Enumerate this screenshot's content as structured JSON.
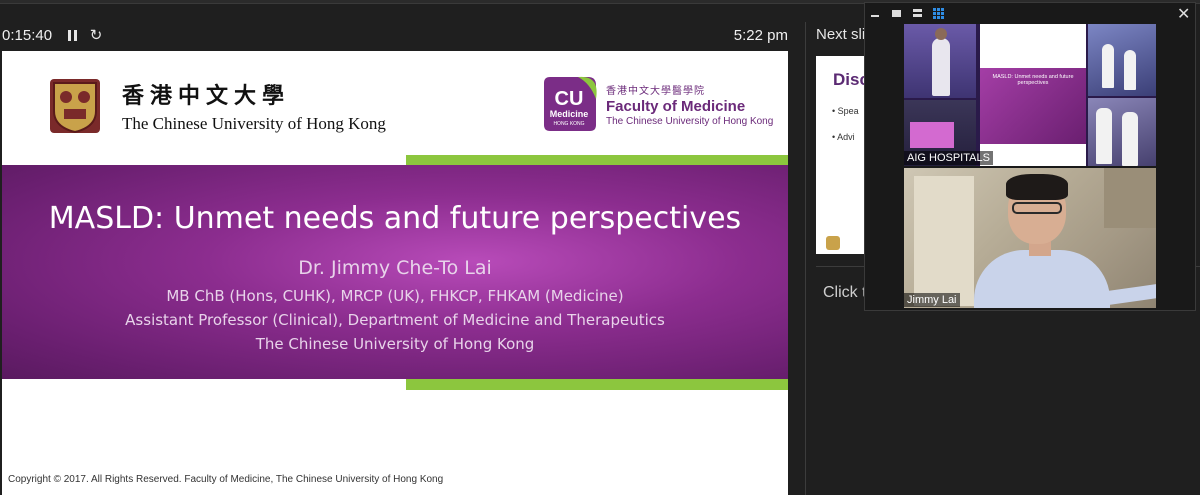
{
  "presenter_bar": {
    "timer": "0:15:40",
    "clock": "5:22 pm"
  },
  "slide": {
    "cuhk_zh": "香港中文大學",
    "cuhk_en": "The Chinese University of Hong Kong",
    "badge_cu": "CU",
    "badge_medicine": "Medicine",
    "badge_hk": "HONG KONG",
    "fom_zh": "香港中文大學醫學院",
    "fom_en": "Faculty of Medicine",
    "fom_sub": "The Chinese University of Hong Kong",
    "title": "MASLD: Unmet needs and future perspectives",
    "presenter": "Dr. Jimmy Che-To Lai",
    "credentials": [
      "MB ChB (Hons, CUHK), MRCP (UK), FHKCP, FHKAM (Medicine)",
      "Assistant Professor (Clinical), Department of Medicine and Therapeutics",
      "The Chinese University of Hong Kong"
    ],
    "copyright": "Copyright © 2017. All Rights Reserved. Faculty of Medicine, The Chinese University of Hong Kong"
  },
  "next_panel": {
    "label": "Next slid",
    "heading": "Disc",
    "bullets": [
      "Spea",
      "Advi"
    ],
    "notes_placeholder": "Click t"
  },
  "video": {
    "tiles": [
      {
        "label": "AIG HOSPITALS"
      },
      {
        "label": "Jimmy Lai"
      }
    ],
    "accent": "#2f8de4"
  },
  "icons": [
    "pause-icon",
    "restart-icon",
    "minimize-icon",
    "single-view-icon",
    "split-view-icon",
    "grid-view-icon",
    "close-icon"
  ]
}
